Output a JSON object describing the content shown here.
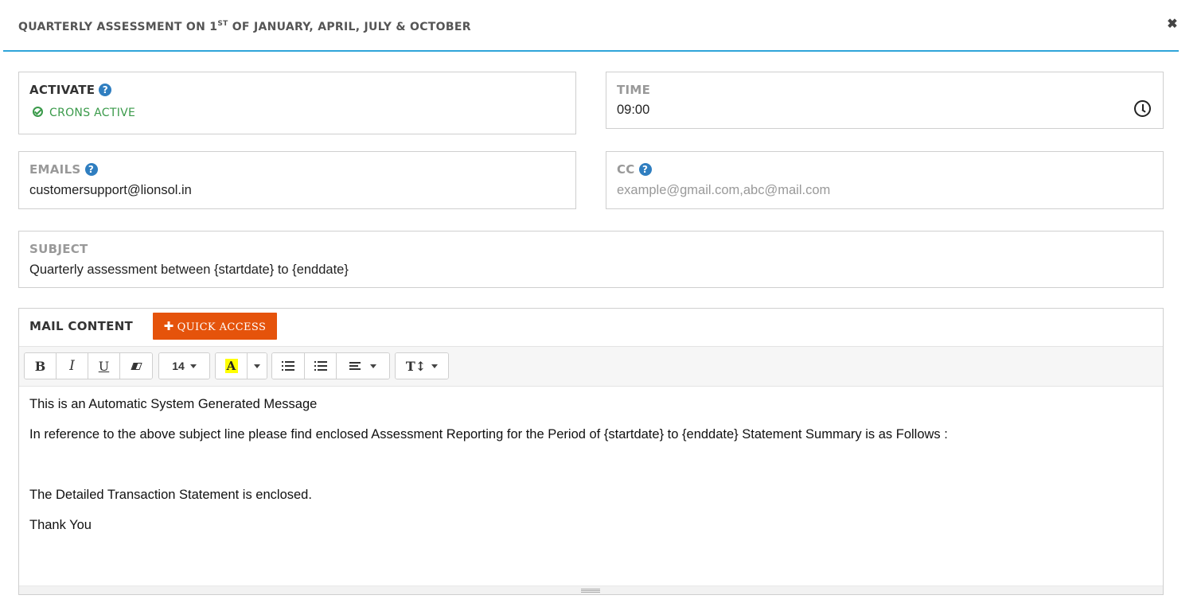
{
  "modal": {
    "title_pre": "QUARTERLY ASSESSMENT ON 1",
    "title_sup": "ST",
    "title_post": " OF JANUARY, APRIL, JULY & OCTOBER",
    "close_icon": "close-icon",
    "close_symbol": "✖",
    "accent_color": "#2fa4d9"
  },
  "activate": {
    "label": "ACTIVATE",
    "help_symbol": "?",
    "status_text": "CRONS ACTIVE",
    "status_color": "#3a9a4a"
  },
  "time": {
    "label": "TIME",
    "value": "09:00",
    "icon": "clock-icon"
  },
  "emails": {
    "label": "EMAILS",
    "help_symbol": "?",
    "value": "customersupport@lionsol.in"
  },
  "cc": {
    "label": "CC",
    "help_symbol": "?",
    "value": "",
    "placeholder": "example@gmail.com,abc@mail.com"
  },
  "subject": {
    "label": "SUBJECT",
    "value": "Quarterly assessment between {startdate} to {enddate}"
  },
  "mail_content": {
    "label": "MAIL CONTENT",
    "quick_access": {
      "plus": "✚",
      "label": "QUICK ACCESS",
      "color": "#e5530b"
    },
    "toolbar": {
      "bold": "B",
      "italic": "I",
      "underline": "U",
      "font_size": "14",
      "highlight": "A",
      "highlight_color": "#ffff00",
      "text_height": "T↕"
    },
    "body": [
      "This is an Automatic System Generated Message",
      "In reference to the above subject line please find enclosed Assessment Reporting for the Period of {startdate} to {enddate} Statement Summary is as Follows :",
      "",
      "The Detailed Transaction Statement is enclosed.",
      "Thank You"
    ]
  }
}
